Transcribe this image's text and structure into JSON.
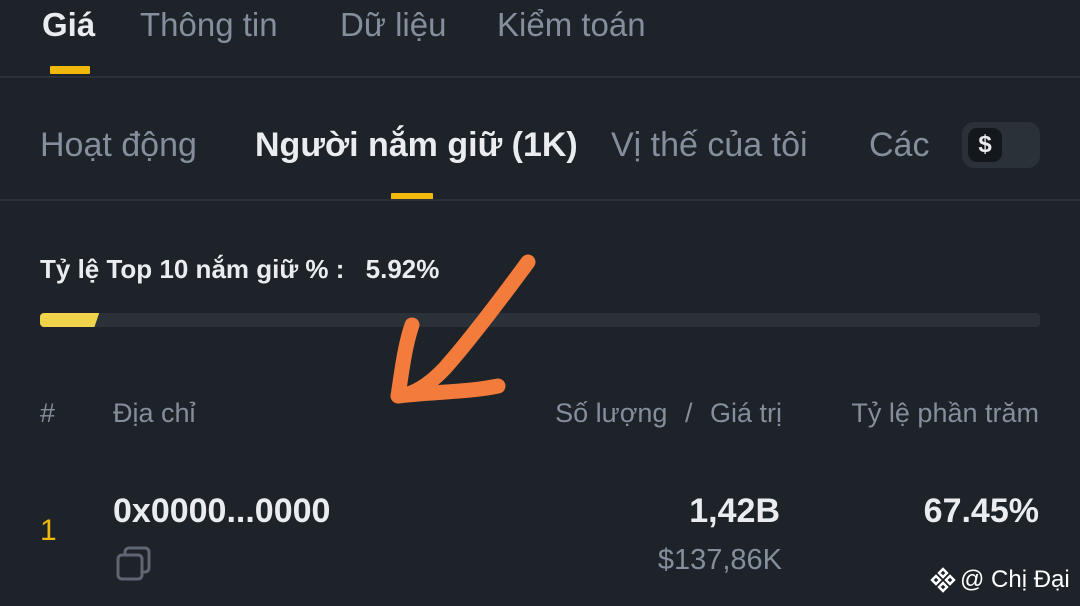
{
  "top_tabs": [
    "Giá",
    "Thông tin",
    "Dữ liệu",
    "Kiểm toán"
  ],
  "sub_tabs": [
    "Hoạt động",
    "Người nắm giữ (1K)",
    "Vị thế của tôi",
    "Các"
  ],
  "currency_toggle": "$",
  "top10": {
    "label": "Tỷ lệ Top 10 nắm giữ % :",
    "value": "5.92%",
    "fill_percent": 5.92
  },
  "table": {
    "headers": {
      "rank": "#",
      "address": "Địa chỉ",
      "quantity": "Số lượng",
      "separator": "/",
      "value": "Giá trị",
      "percent": "Tỷ lệ phần trăm"
    },
    "rows": [
      {
        "rank": "1",
        "address": "0x0000...0000",
        "quantity": "1,42B",
        "value": "$137,86K",
        "percent": "67.45%"
      }
    ]
  },
  "annotation": {
    "color": "#f37b3b"
  },
  "watermark": "@ Chị Đại",
  "colors": {
    "background": "#1e2329",
    "accent": "#f0b90b",
    "muted": "#848e9c",
    "text": "#eaecef"
  }
}
